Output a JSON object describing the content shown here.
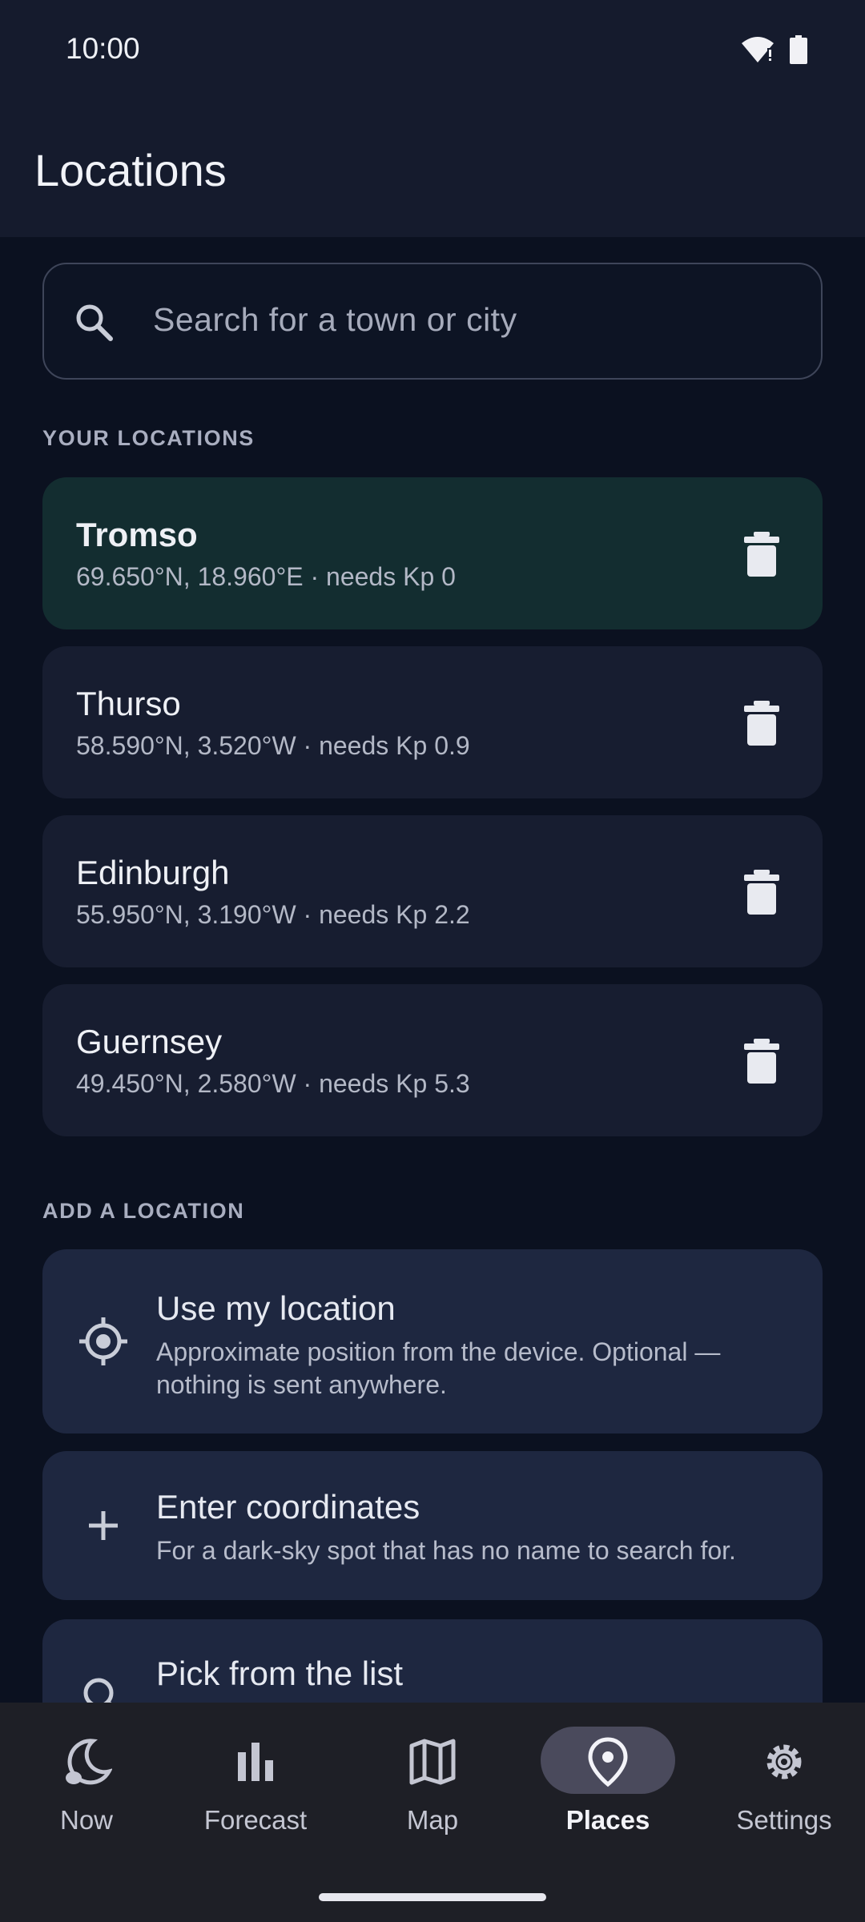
{
  "status_bar": {
    "time": "10:00"
  },
  "app_bar": {
    "title": "Locations"
  },
  "search": {
    "placeholder": "Search for a town or city"
  },
  "your_locations": {
    "label": "YOUR LOCATIONS",
    "items": [
      {
        "name": "Tromso",
        "detail": "69.650°N, 18.960°E · needs Kp 0",
        "active": true
      },
      {
        "name": "Thurso",
        "detail": "58.590°N, 3.520°W · needs Kp 0.9",
        "active": false
      },
      {
        "name": "Edinburgh",
        "detail": "55.950°N, 3.190°W · needs Kp 2.2",
        "active": false
      },
      {
        "name": "Guernsey",
        "detail": "49.450°N, 2.580°W · needs Kp 5.3",
        "active": false
      }
    ]
  },
  "add_location": {
    "label": "ADD A LOCATION",
    "options": [
      {
        "icon": "my-location-icon",
        "title": "Use my location",
        "desc": "Approximate position from the device. Optional — nothing is sent anywhere."
      },
      {
        "icon": "plus-icon",
        "title": "Enter coordinates",
        "desc": "For a dark-sky spot that has no name to search for."
      },
      {
        "icon": "search-icon",
        "title": "Pick from the list",
        "desc": ""
      }
    ]
  },
  "bottom_nav": {
    "items": [
      {
        "label": "Now",
        "icon": "moon-icon"
      },
      {
        "label": "Forecast",
        "icon": "bar-chart-icon"
      },
      {
        "label": "Map",
        "icon": "map-icon"
      },
      {
        "label": "Places",
        "icon": "location-pin-icon",
        "selected": true
      },
      {
        "label": "Settings",
        "icon": "gear-icon"
      }
    ]
  },
  "colors": {
    "accent_card": "#132d30",
    "card": "#171d30",
    "add_card": "#1e2740",
    "background": "#0b1120"
  }
}
